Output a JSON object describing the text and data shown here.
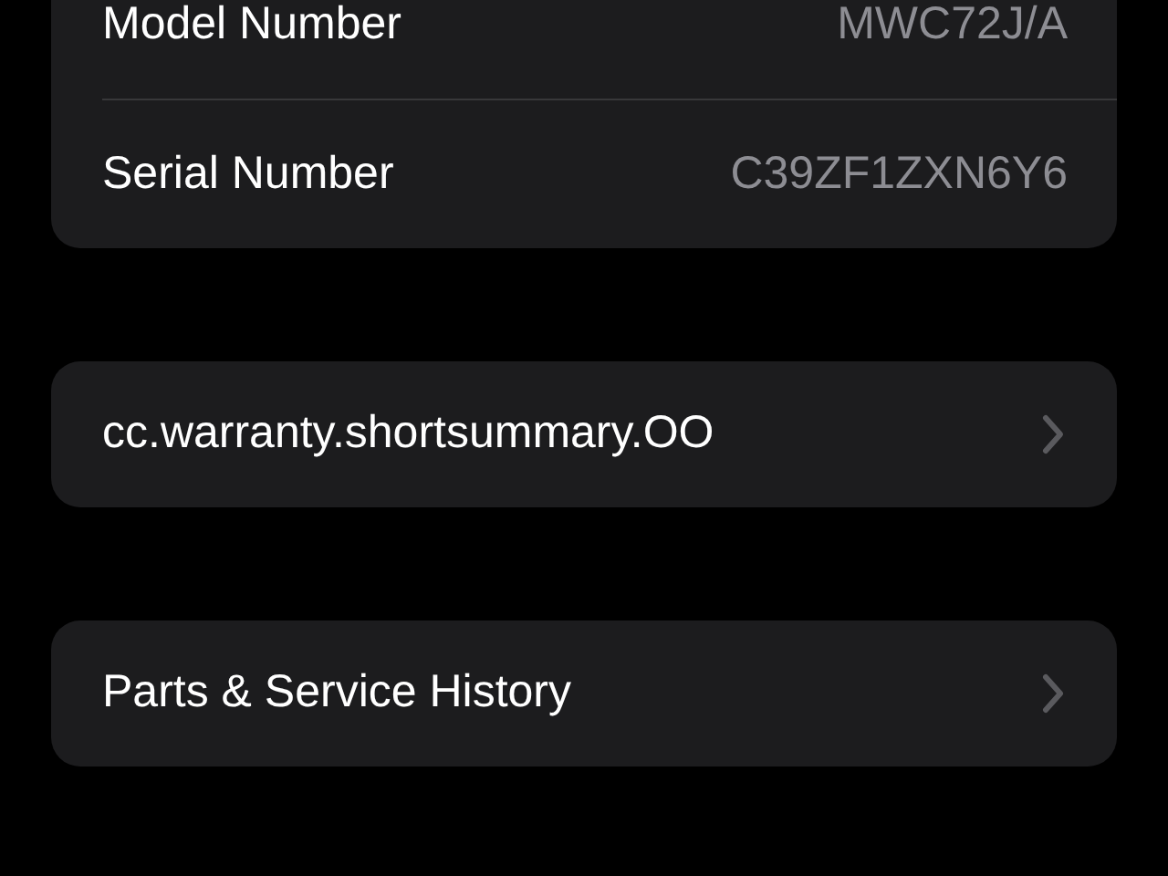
{
  "info_rows": [
    {
      "label": "Model Number",
      "value": "MWC72J/A"
    },
    {
      "label": "Serial Number",
      "value": "C39ZF1ZXN6Y6"
    }
  ],
  "link_groups": [
    {
      "label": "cc.warranty.shortsummary.OO"
    },
    {
      "label": "Parts & Service History"
    }
  ]
}
